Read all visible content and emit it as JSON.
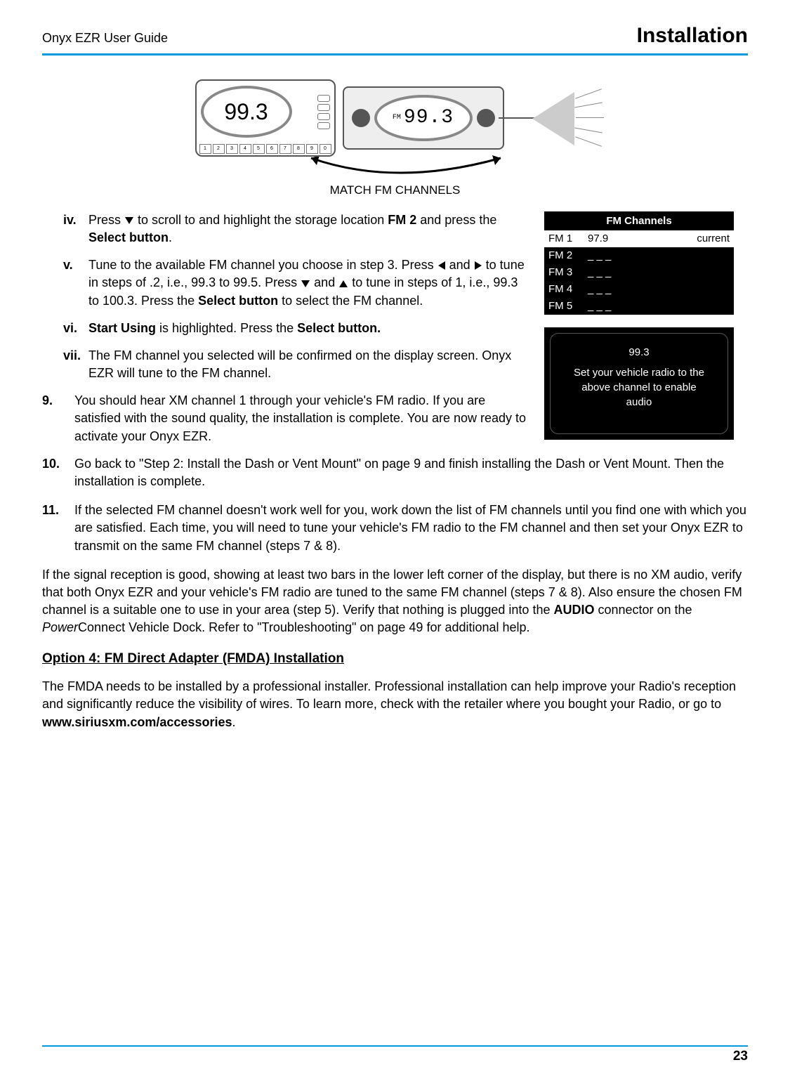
{
  "header": {
    "doc_title": "Onyx EZR User Guide",
    "section_title": "Installation"
  },
  "figure": {
    "onyx_freq": "99.3",
    "radio_band": "FM",
    "radio_freq": "99.3",
    "caption": "MATCH FM CHANNELS",
    "preset_labels": [
      "1",
      "2",
      "3",
      "4",
      "5",
      "6",
      "7",
      "8",
      "9",
      "0"
    ]
  },
  "steps": {
    "iv": {
      "marker": "iv.",
      "t1": "Press ",
      "t2": " to scroll to and highlight the storage location ",
      "b1": "FM 2",
      "t3": " and press the ",
      "b2": "Select button",
      "t4": "."
    },
    "v": {
      "marker": "v.",
      "t1": "Tune to the available FM channel you choose in step 3. Press ",
      "t2": " and ",
      "t3": " to tune in steps of .2, i.e., 99.3 to 99.5. Press ",
      "t4": " and ",
      "t5": " to tune in steps of 1, i.e., 99.3 to 100.3. Press the ",
      "b1": "Select button",
      "t6": " to select the FM channel."
    },
    "vi": {
      "marker": "vi.",
      "b1": "Start Using",
      "t1": " is highlighted. Press the ",
      "b2": "Select button."
    },
    "vii": {
      "marker": "vii.",
      "t1": "The FM channel you selected will be confirmed on the display screen. Onyx EZR will tune to the FM channel."
    },
    "s9": {
      "marker": "9.",
      "t1": "You should hear XM channel 1 through your vehicle's FM radio. If you are satisfied with the sound quality, the installation is complete. You are now ready to activate your Onyx EZR."
    },
    "s10": {
      "marker": "10.",
      "t1": "Go back to \"Step 2: Install the Dash or Vent Mount\" on page 9 and finish installing the Dash or Vent Mount. Then the installation is complete."
    },
    "s11": {
      "marker": "11.",
      "t1": "If the selected FM channel doesn't work well for you, work down the list of FM channels until you find one with which you are satisfied. Each time, you will need to tune your vehicle's FM radio to the FM channel and then set your Onyx EZR to transmit on the same FM channel (steps 7 & 8)."
    }
  },
  "fm_table": {
    "title": "FM Channels",
    "rows": [
      {
        "label": "FM 1",
        "value": "97.9",
        "tag": "current"
      },
      {
        "label": "FM 2",
        "value": "_ _ _",
        "tag": ""
      },
      {
        "label": "FM 3",
        "value": "_ _ _",
        "tag": ""
      },
      {
        "label": "FM 4",
        "value": "_ _ _",
        "tag": ""
      },
      {
        "label": "FM 5",
        "value": "_ _ _",
        "tag": ""
      }
    ]
  },
  "confirm": {
    "freq": "99.3",
    "msg": "Set your vehicle radio to the above channel to enable audio"
  },
  "troubleshoot": {
    "t1": "If the signal reception is good, showing at least two bars in the lower left corner of the display, but there is no XM audio, verify that both Onyx EZR and your vehicle's FM radio are tuned to the same FM channel (steps 7 & 8). Also ensure the chosen FM channel is a suitable one to use in your area (step 5). Verify that nothing is plugged into the ",
    "b1": "AUDIO",
    "t2": " connector on the ",
    "i1": "Power",
    "t3": "Connect Vehicle Dock. Refer to \"Troubleshooting\" on page 49 for additional help."
  },
  "option4": {
    "heading": "Option 4: FM Direct Adapter (FMDA) Installation",
    "t1": "The FMDA needs to be installed by a professional installer. Professional installation can help improve your Radio's reception and significantly reduce the visibility of wires. To learn more, check with the retailer where you bought your Radio, or go to ",
    "b1": "www.siriusxm.com/accessories",
    "t2": "."
  },
  "page_number": "23"
}
